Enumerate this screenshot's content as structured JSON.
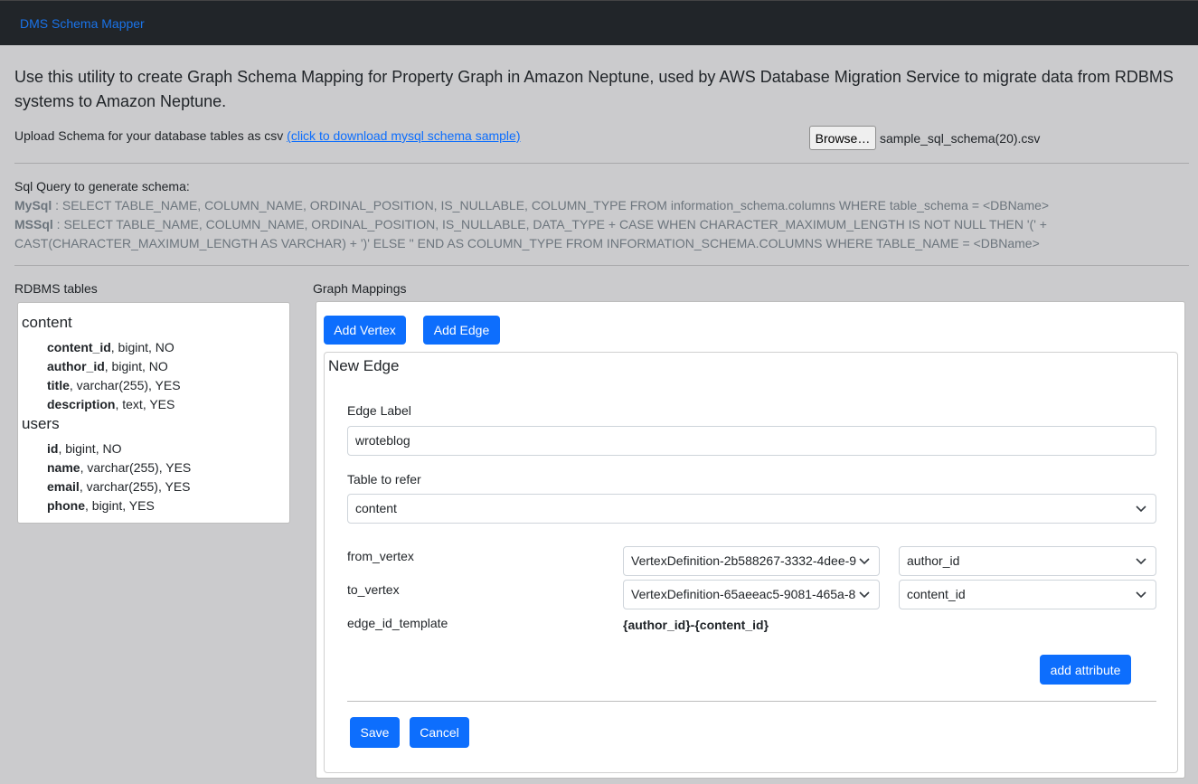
{
  "navbar": {
    "brand": "DMS Schema Mapper"
  },
  "intro": "Use this utility to create Graph Schema Mapping for Property Graph in Amazon Neptune, used by AWS Database Migration Service to migrate data from RDBMS systems to Amazon Neptune.",
  "upload": {
    "label": "Upload Schema for your database tables as csv ",
    "link": "(click to download mysql schema sample)",
    "browse_label": "Browse…",
    "filename": "sample_sql_schema(20).csv"
  },
  "sql": {
    "title": "Sql Query to generate schema:",
    "mysql_label": "MySql",
    "mysql_query": " : SELECT TABLE_NAME, COLUMN_NAME, ORDINAL_POSITION, IS_NULLABLE, COLUMN_TYPE FROM information_schema.columns WHERE table_schema = <DBName>",
    "mssql_label": "MSSql",
    "mssql_query": " : SELECT TABLE_NAME, COLUMN_NAME, ORDINAL_POSITION, IS_NULLABLE, DATA_TYPE + CASE WHEN CHARACTER_MAXIMUM_LENGTH IS NOT NULL THEN '(' +",
    "mssql_query_cont": "CAST(CHARACTER_MAXIMUM_LENGTH AS VARCHAR) + ')' ELSE '' END AS COLUMN_TYPE FROM INFORMATION_SCHEMA.COLUMNS WHERE TABLE_NAME = <DBName>"
  },
  "rdbms": {
    "label": "RDBMS tables",
    "tables": [
      {
        "name": "content",
        "columns": [
          {
            "name": "content_id",
            "meta": ", bigint, NO"
          },
          {
            "name": "author_id",
            "meta": ", bigint, NO"
          },
          {
            "name": "title",
            "meta": ", varchar(255), YES"
          },
          {
            "name": "description",
            "meta": ", text, YES"
          }
        ]
      },
      {
        "name": "users",
        "columns": [
          {
            "name": "id",
            "meta": ", bigint, NO"
          },
          {
            "name": "name",
            "meta": ", varchar(255), YES"
          },
          {
            "name": "email",
            "meta": ", varchar(255), YES"
          },
          {
            "name": "phone",
            "meta": ", bigint, YES"
          }
        ]
      }
    ]
  },
  "graph": {
    "label": "Graph Mappings",
    "add_vertex": "Add Vertex",
    "add_edge": "Add Edge",
    "edge_form": {
      "title": "New Edge",
      "edge_label_label": "Edge Label",
      "edge_label_value": "wroteblog",
      "table_label": "Table to refer",
      "table_value": "content",
      "from_label": "from_vertex",
      "from_vertex": "VertexDefinition-2b588267-3332-4dee-9",
      "from_column": "author_id",
      "to_label": "to_vertex",
      "to_vertex": "VertexDefinition-65aeeac5-9081-465a-8",
      "to_column": "content_id",
      "template_label": "edge_id_template",
      "template_value": "{author_id}-{content_id}",
      "add_attribute": "add attribute",
      "save": "Save",
      "cancel": "Cancel"
    }
  },
  "colors": {
    "primary": "#0d6efd",
    "navbar": "#212529",
    "background": "#cbcbcd"
  }
}
